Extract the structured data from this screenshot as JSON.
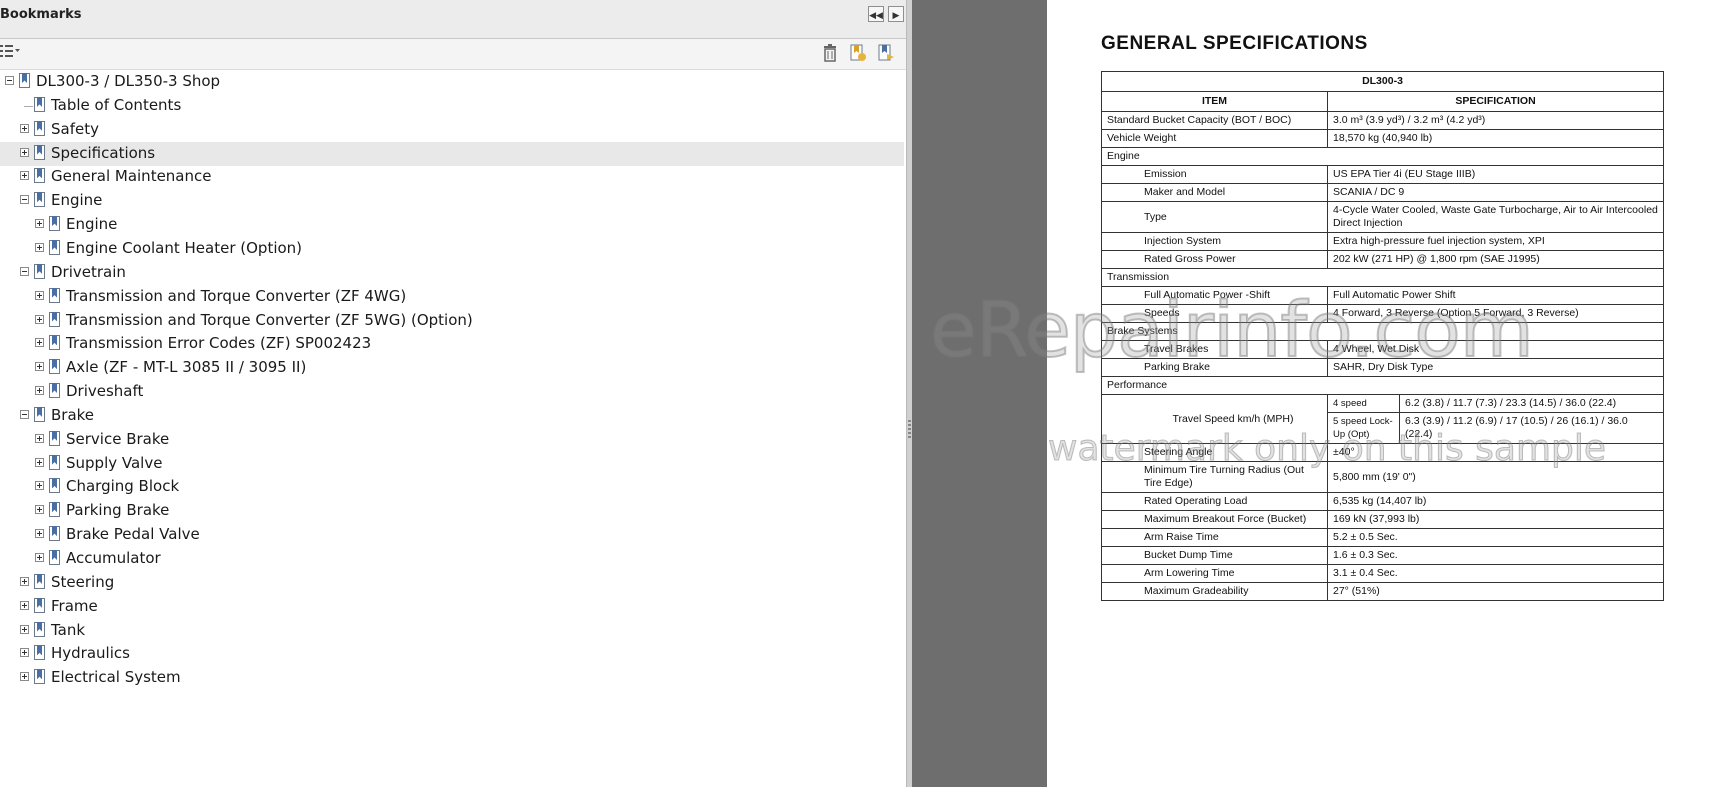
{
  "bookmarks_panel": {
    "title": "Bookmarks",
    "collapse_icon": "double-left-arrow-icon",
    "expand_icon": "right-arrow-icon",
    "options_icon": "options-menu-icon",
    "delete_icon": "trash-icon",
    "new_bookmark_icon": "new-bookmark-icon",
    "expand_current_icon": "expand-current-bookmark-icon",
    "tree": [
      {
        "label": "DL300-3 / DL350-3 Shop",
        "level": 0,
        "expander": "minus"
      },
      {
        "label": "Table of Contents",
        "level": 1,
        "expander": "none"
      },
      {
        "label": "Safety",
        "level": 1,
        "expander": "plus"
      },
      {
        "label": "Specifications",
        "level": 1,
        "expander": "plus",
        "selected": true
      },
      {
        "label": "General Maintenance",
        "level": 1,
        "expander": "plus"
      },
      {
        "label": "Engine",
        "level": 1,
        "expander": "minus"
      },
      {
        "label": "Engine",
        "level": 2,
        "expander": "plus"
      },
      {
        "label": "Engine Coolant Heater (Option)",
        "level": 2,
        "expander": "plus"
      },
      {
        "label": "Drivetrain",
        "level": 1,
        "expander": "minus"
      },
      {
        "label": "Transmission and Torque Converter (ZF 4WG)",
        "level": 2,
        "expander": "plus"
      },
      {
        "label": "Transmission and Torque Converter (ZF 5WG) (Option)",
        "level": 2,
        "expander": "plus"
      },
      {
        "label": "Transmission Error Codes (ZF) SP002423",
        "level": 2,
        "expander": "plus"
      },
      {
        "label": "Axle (ZF - MT-L 3085 II / 3095 II)",
        "level": 2,
        "expander": "plus"
      },
      {
        "label": "Driveshaft",
        "level": 2,
        "expander": "plus"
      },
      {
        "label": "Brake",
        "level": 1,
        "expander": "minus"
      },
      {
        "label": "Service Brake",
        "level": 2,
        "expander": "plus"
      },
      {
        "label": "Supply Valve",
        "level": 2,
        "expander": "plus"
      },
      {
        "label": "Charging Block",
        "level": 2,
        "expander": "plus"
      },
      {
        "label": "Parking Brake",
        "level": 2,
        "expander": "plus"
      },
      {
        "label": "Brake Pedal Valve",
        "level": 2,
        "expander": "plus"
      },
      {
        "label": "Accumulator",
        "level": 2,
        "expander": "plus"
      },
      {
        "label": "Steering",
        "level": 1,
        "expander": "plus"
      },
      {
        "label": "Frame",
        "level": 1,
        "expander": "plus"
      },
      {
        "label": "Tank",
        "level": 1,
        "expander": "plus"
      },
      {
        "label": "Hydraulics",
        "level": 1,
        "expander": "plus"
      },
      {
        "label": "Electrical System",
        "level": 1,
        "expander": "plus"
      }
    ]
  },
  "document": {
    "heading": "GENERAL SPECIFICATIONS",
    "model": "DL300-3",
    "col_item": "ITEM",
    "col_spec": "SPECIFICATION",
    "rows": [
      {
        "item": "Standard Bucket Capacity (BOT / BOC)",
        "spec": "3.0 m³ (3.9 yd³) / 3.2 m³ (4.2 yd³)"
      },
      {
        "item": "Vehicle Weight",
        "spec": "18,570 kg (40,940 lb)"
      },
      {
        "section": "Engine"
      },
      {
        "item": "Emission",
        "spec": "US EPA Tier 4i (EU Stage IIIB)",
        "indent": true
      },
      {
        "item": "Maker and Model",
        "spec": "SCANIA / DC 9",
        "indent": true
      },
      {
        "item": "Type",
        "spec": "4-Cycle Water Cooled, Waste Gate Turbocharge, Air to Air Intercooled Direct Injection",
        "indent": true
      },
      {
        "item": "Injection System",
        "spec": "Extra high-pressure fuel injection system, XPI",
        "indent": true
      },
      {
        "item": "Rated Gross Power",
        "spec": "202 kW (271 HP) @ 1,800 rpm (SAE J1995)",
        "indent": true
      },
      {
        "section": "Transmission"
      },
      {
        "item": "Full Automatic Power -Shift",
        "spec": "Full Automatic Power Shift",
        "indent": true
      },
      {
        "item": "Speeds",
        "spec": "4 Forward, 3 Reverse (Option 5 Forward, 3 Reverse)",
        "indent": true
      },
      {
        "section": "Brake Systems"
      },
      {
        "item": "Travel Brakes",
        "spec": "4 Wheel, Wet Disk",
        "indent": true
      },
      {
        "item": "Parking Brake",
        "spec": "SAHR, Dry Disk Type",
        "indent": true
      },
      {
        "section": "Performance"
      },
      {
        "item": "Travel Speed km/h (MPH)",
        "split": [
          {
            "sub": "4 speed",
            "spec": "6.2 (3.8) / 11.7 (7.3) / 23.3 (14.5) / 36.0 (22.4)"
          },
          {
            "sub": "5 speed Lock-Up (Opt)",
            "spec": "6.3 (3.9) / 11.2 (6.9) / 17 (10.5) / 26 (16.1) / 36.0 (22.4)"
          }
        ],
        "indent": true
      },
      {
        "item": "Steering Angle",
        "spec": "±40°",
        "indent": true
      },
      {
        "item": "Minimum Tire Turning Radius (Out Tire Edge)",
        "spec": "5,800 mm (19' 0\")",
        "indent": true
      },
      {
        "item": "Rated Operating Load",
        "spec": "6,535 kg (14,407 lb)",
        "indent": true
      },
      {
        "item": "Maximum Breakout Force (Bucket)",
        "spec": "169 kN (37,993 lb)",
        "indent": true
      },
      {
        "item": "Arm Raise Time",
        "spec": "5.2 ± 0.5 Sec.",
        "indent": true
      },
      {
        "item": "Bucket Dump Time",
        "spec": "1.6 ± 0.3 Sec.",
        "indent": true
      },
      {
        "item": "Arm Lowering Time",
        "spec": "3.1 ± 0.4 Sec.",
        "indent": true
      },
      {
        "item": "Maximum Gradeability",
        "spec": "27° (51%)",
        "indent": true
      }
    ],
    "watermark_main": "eRepairinfo.com",
    "watermark_sub": "watermark only on this sample"
  }
}
